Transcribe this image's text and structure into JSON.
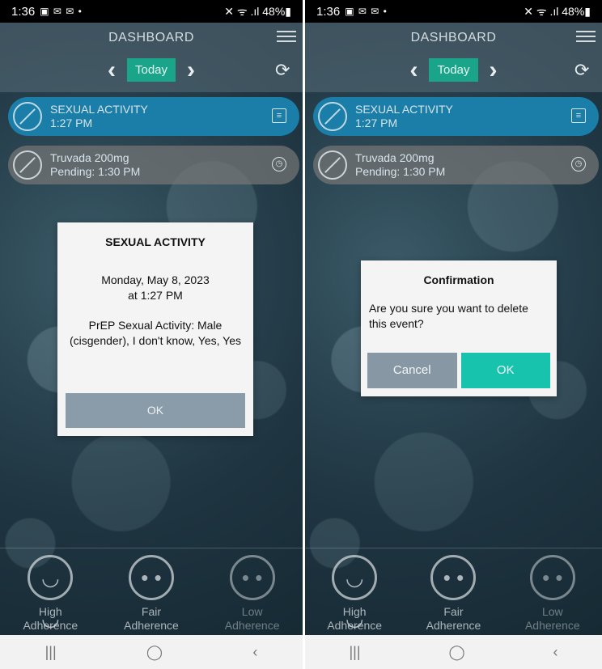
{
  "status_bar": {
    "time": "1:36",
    "notif_icons": "▣ ✉ ✉ •",
    "right": "✕ ᯤ .ıl 48%▮"
  },
  "header": {
    "title": "DASHBOARD",
    "today_label": "Today"
  },
  "events": [
    {
      "title": "SEXUAL ACTIVITY",
      "subtitle": "1:27 PM",
      "side_icon": "≡"
    },
    {
      "title": "Truvada 200mg",
      "subtitle": "Pending: 1:30 PM",
      "side_icon": "◷"
    }
  ],
  "adherence": [
    {
      "line1": "High",
      "line2": "Adherence",
      "glyph": "◡ ◡"
    },
    {
      "line1": "Fair",
      "line2": "Adherence",
      "glyph": "• •"
    },
    {
      "line1": "Low",
      "line2": "Adherence",
      "glyph": "• •"
    }
  ],
  "info_dialog": {
    "title": "SEXUAL ACTIVITY",
    "date_line1": "Monday, May 8, 2023",
    "date_line2": "at 1:27 PM",
    "detail": "PrEP Sexual Activity: Male (cisgender), I don't know, Yes, Yes",
    "ok_label": "OK"
  },
  "confirm_dialog": {
    "title": "Confirmation",
    "message": "Are you sure you want to delete this event?",
    "cancel_label": "Cancel",
    "ok_label": "OK"
  },
  "nav_bar": {
    "recents": "|||",
    "home": "◯",
    "back": "‹"
  },
  "colors": {
    "accent": "#1aa58a",
    "event_active": "#1a7ea8",
    "confirm_ok": "#18c3ad"
  }
}
